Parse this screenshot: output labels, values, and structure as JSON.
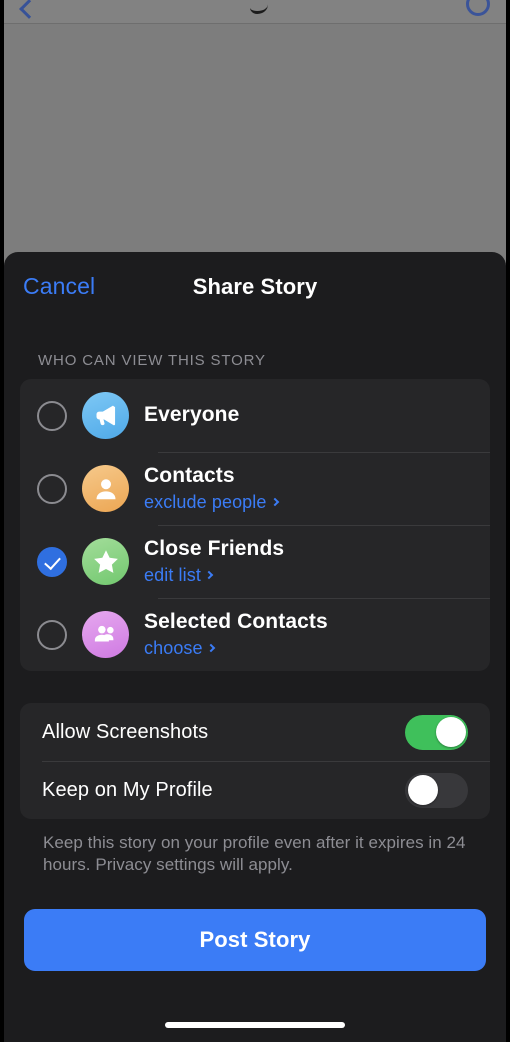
{
  "sheet": {
    "cancel_label": "Cancel",
    "title": "Share Story",
    "section_label": "WHO CAN VIEW THIS STORY"
  },
  "audience": {
    "options": [
      {
        "title": "Everyone",
        "link": "",
        "icon": "megaphone-icon",
        "selected": false,
        "icon_color": "#4fa9e8"
      },
      {
        "title": "Contacts",
        "link": "exclude people",
        "icon": "person-icon",
        "selected": false,
        "icon_color": "#eca653"
      },
      {
        "title": "Close Friends",
        "link": "edit list",
        "icon": "star-icon",
        "selected": true,
        "icon_color": "#72c86f"
      },
      {
        "title": "Selected Contacts",
        "link": "choose",
        "icon": "people-group-icon",
        "selected": false,
        "icon_color": "#cf7ae2"
      }
    ]
  },
  "settings": {
    "rows": [
      {
        "label": "Allow Screenshots",
        "on": true
      },
      {
        "label": "Keep on My Profile",
        "on": false
      }
    ],
    "footnote": "Keep this story on your profile even after it expires in 24 hours. Privacy settings will apply."
  },
  "actions": {
    "post_label": "Post Story"
  },
  "colors": {
    "accent_blue": "#3b7cf6",
    "toggle_on_green": "#3fc05b",
    "sheet_bg": "#1c1c1e",
    "card_bg": "#262628",
    "secondary_text": "#8d8d93"
  }
}
